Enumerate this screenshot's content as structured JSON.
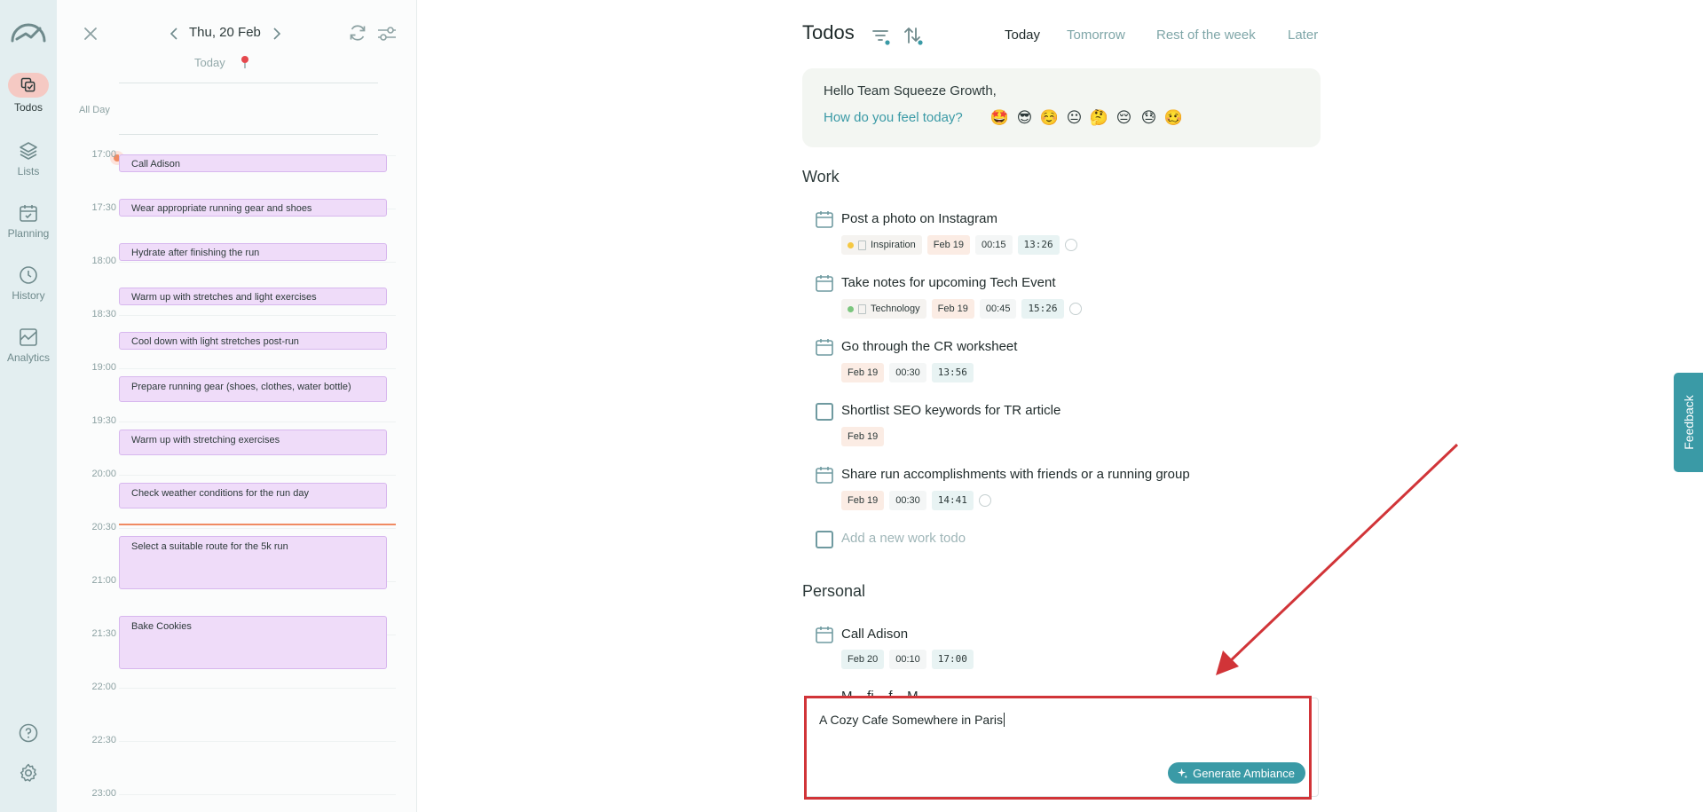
{
  "nav": {
    "items": [
      {
        "label": "Todos",
        "icon": "todos-icon",
        "active": true
      },
      {
        "label": "Lists",
        "icon": "layers-icon"
      },
      {
        "label": "Planning",
        "icon": "calendar-check-icon"
      },
      {
        "label": "History",
        "icon": "clock-icon"
      },
      {
        "label": "Analytics",
        "icon": "chart-icon"
      }
    ]
  },
  "calendar": {
    "date": "Thu, 20 Feb",
    "today_label": "Today",
    "all_day_label": "All Day",
    "hours": [
      "17:00",
      "17:30",
      "18:00",
      "18:30",
      "19:00",
      "19:30",
      "20:00",
      "20:30",
      "21:00",
      "21:30",
      "22:00",
      "22:30",
      "23:00"
    ],
    "events": [
      "Call Adison",
      "Wear appropriate running gear and shoes",
      "Hydrate after finishing the run",
      "Warm up with stretches and light exercises",
      "Cool down with light stretches post-run",
      "Prepare running gear (shoes, clothes, water bottle)",
      "Warm up with stretching exercises",
      "Check weather conditions for the run day",
      "Select a suitable route for the 5k run",
      "Bake Cookies"
    ]
  },
  "main": {
    "title": "Todos",
    "tabs": [
      "Today",
      "Tomorrow",
      "Rest of the week",
      "Later"
    ],
    "greeting": {
      "hello": "Hello Team Squeeze Growth,",
      "question": "How do you feel today?",
      "emojis": [
        "🤩",
        "😎",
        "☺️",
        "😐",
        "🤔",
        "😔",
        "😓",
        "🥴"
      ]
    },
    "work": {
      "heading": "Work",
      "todos": [
        {
          "title": "Post a photo on Instagram",
          "tag": "Inspiration",
          "date": "Feb 19",
          "duration": "00:15",
          "time": "13:26"
        },
        {
          "title": "Take notes for upcoming Tech Event",
          "tag": "Technology",
          "date": "Feb 19",
          "duration": "00:45",
          "time": "15:26"
        },
        {
          "title": "Go through the CR worksheet",
          "date": "Feb 19",
          "duration": "00:30",
          "time": "13:56"
        },
        {
          "title": "Shortlist SEO keywords for TR article",
          "date": "Feb 19"
        },
        {
          "title": "Share run accomplishments with friends or a running group",
          "date": "Feb 19",
          "duration": "00:30",
          "time": "14:41"
        }
      ],
      "add_placeholder": "Add a new work todo"
    },
    "personal": {
      "heading": "Personal",
      "todos": [
        {
          "title": "Call Adison",
          "date": "Feb 20",
          "duration": "00:10",
          "time": "17:00"
        }
      ],
      "occluded_text": "M... fi... f... M..."
    }
  },
  "popup": {
    "input_value": "A Cozy Cafe Somewhere in Paris",
    "generate_label": "Generate Ambiance"
  },
  "feedback_label": "Feedback",
  "colors": {
    "accent": "#3a9aa6",
    "event_fill": "#efdcf9",
    "now_line": "#f08a62",
    "annotation": "#d13438"
  }
}
